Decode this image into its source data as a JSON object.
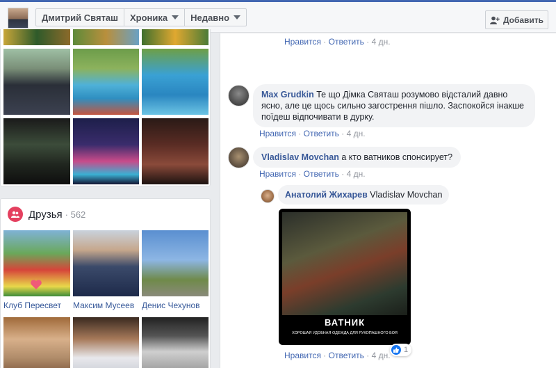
{
  "header": {
    "profile_name": "Дмитрий Святаш",
    "timeline_label": "Хроника",
    "recent_label": "Недавно",
    "add_label": "Добавить"
  },
  "friends": {
    "label": "Друзья",
    "count": "· 562",
    "items": [
      {
        "name": "Клуб Пересвет"
      },
      {
        "name": "Максим Мусеев"
      },
      {
        "name": "Денис Чехунов"
      }
    ]
  },
  "actions": {
    "like": "Нравится",
    "reply": "Ответить",
    "sep": "·",
    "age": "4 дн."
  },
  "comments": [
    {
      "author": "Max Grudkin",
      "text": "Те що Дімка Святаш розумово відсталий давно ясно, але це щось сильно загострення пішло. Заспокойся інакше поїдеш відпочивати в дурку."
    },
    {
      "author": "Vladislav Movchan",
      "text": "а кто ватников спонсирует?"
    },
    {
      "author": "Анатолий Жихарев",
      "text": "Vladislav Movchan"
    }
  ],
  "meme": {
    "title": "ВАТНИК",
    "subtitle": "ХОРОШАЯ УДОБНАЯ ОДЕЖДА ДЛЯ РУКОПАШНОГО БОЯ"
  },
  "reactions": {
    "count": "1"
  },
  "colors": {
    "accent": "#4267b2",
    "link": "#385898",
    "meta": "#90949c",
    "bubble": "#f2f3f5"
  }
}
